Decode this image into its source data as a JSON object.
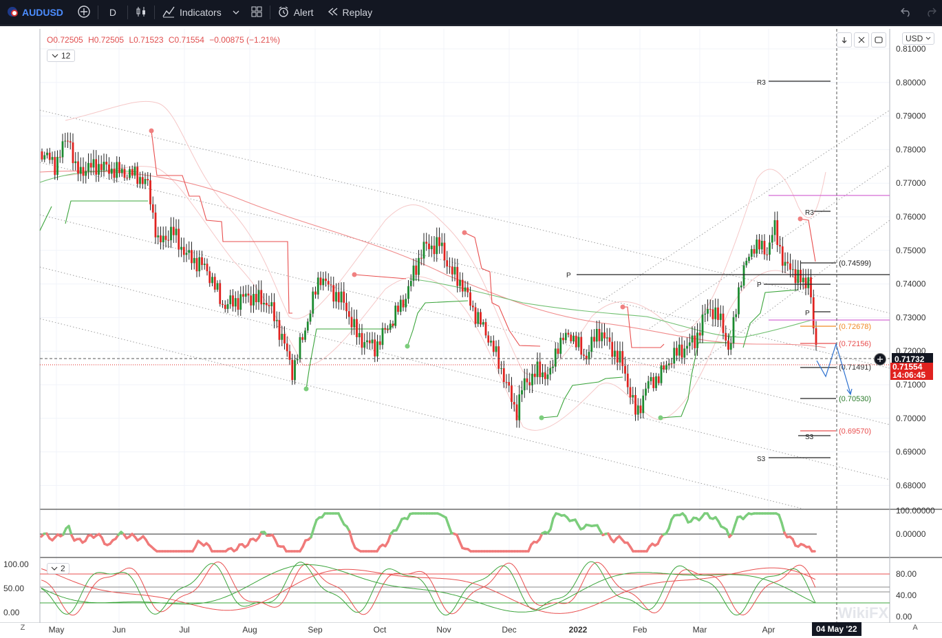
{
  "topbar": {
    "symbol": "AUDUSD",
    "interval": "D",
    "indicators_label": "Indicators",
    "alert_label": "Alert",
    "replay_label": "Replay"
  },
  "legend": {
    "open": "O0.72505",
    "high": "H0.72505",
    "low": "L0.71523",
    "close": "C0.71554",
    "change": "−0.00875 (−1.21%)",
    "indicator_count": "12"
  },
  "currency": "USD",
  "price_axis": {
    "labels": [
      "0.81000",
      "0.80000",
      "0.79000",
      "0.78000",
      "0.77000",
      "0.76000",
      "0.75000",
      "0.74000",
      "0.73000",
      "0.72000",
      "0.71000",
      "0.70000",
      "0.69000",
      "0.68000"
    ],
    "current_price": "0.71732",
    "close_price": "0.71554",
    "countdown": "14:06:45"
  },
  "osc1_axis": {
    "labels": [
      "100.00000",
      "0.00000"
    ]
  },
  "osc2_axis": {
    "left_labels": [
      "100.00",
      "50.00",
      "0.00"
    ],
    "right_labels": [
      "80.00",
      "40.00",
      "0.00"
    ],
    "indicator_count": "2"
  },
  "time_axis": {
    "labels": [
      "May",
      "Jun",
      "Jul",
      "Aug",
      "Sep",
      "Oct",
      "Nov",
      "Dec",
      "2022",
      "Feb",
      "Mar",
      "Apr"
    ],
    "cursor_date": "04 May '22",
    "left_btn": "Z",
    "right_btn": "A"
  },
  "pivot_labels": {
    "r3_top": "R3",
    "r3_mid": "R3",
    "p_long": "P",
    "p_mid": "P",
    "p_short": "P",
    "s3_mid": "S3",
    "s3_low": "S3"
  },
  "level_labels": [
    "(0.74599)",
    "(0.72678)",
    "(0.72156)",
    "(0.71491)",
    "(0.70530)",
    "(0.69570)"
  ],
  "watermark": "WikiFX",
  "colors": {
    "bull": "#26a69a",
    "bear": "#ef5350",
    "candle_up": "#1b8a2f",
    "candle_down": "#e0221f",
    "accent": "#2962ff"
  }
}
